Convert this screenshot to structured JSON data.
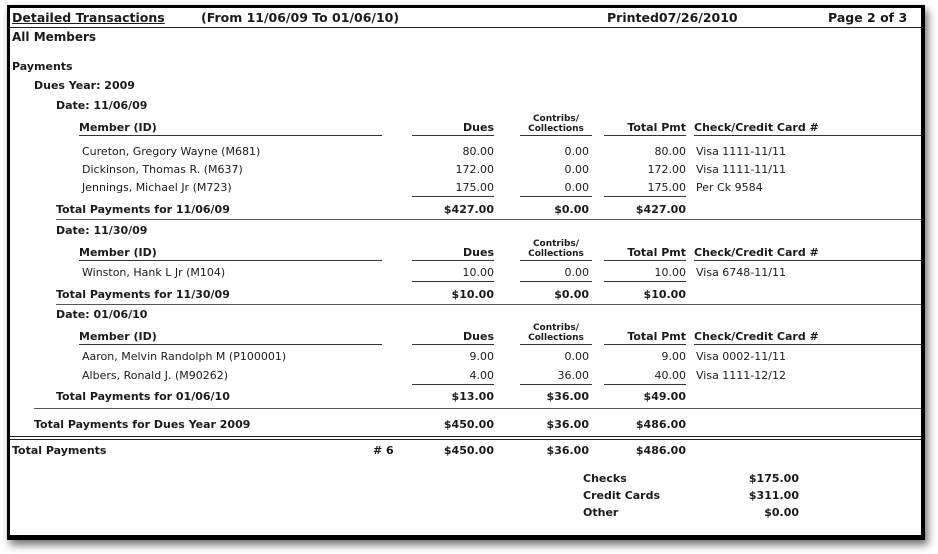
{
  "header": {
    "title": "Detailed Transactions",
    "range": "(From 11/06/09 To 01/06/10)",
    "printed": "Printed07/26/2010",
    "page": "Page 2 of 3",
    "scope": "All Members"
  },
  "section": "Payments",
  "dues_year_label": "Dues Year:  2009",
  "columns": {
    "member": "Member (ID)",
    "dues": "Dues",
    "contribs_1": "Contribs/",
    "contribs_2": "Collections",
    "total": "Total Pmt",
    "card": "Check/Credit Card #"
  },
  "groups": [
    {
      "date_label": "Date:  11/06/09",
      "rows": [
        {
          "member": "Cureton, Gregory Wayne (M681)",
          "dues": "80.00",
          "contribs": "0.00",
          "total": "80.00",
          "card": "Visa 1111-11/11"
        },
        {
          "member": "Dickinson, Thomas R. (M637)",
          "dues": "172.00",
          "contribs": "0.00",
          "total": "172.00",
          "card": "Visa 1111-11/11"
        },
        {
          "member": "Jennings, Michael Jr (M723)",
          "dues": "175.00",
          "contribs": "0.00",
          "total": "175.00",
          "card": "Per Ck 9584"
        }
      ],
      "total_label": "Total Payments for 11/06/09",
      "total_dues": "$427.00",
      "total_contribs": "$0.00",
      "total_total": "$427.00"
    },
    {
      "date_label": "Date:  11/30/09",
      "rows": [
        {
          "member": "Winston, Hank L Jr (M104)",
          "dues": "10.00",
          "contribs": "0.00",
          "total": "10.00",
          "card": "Visa 6748-11/11"
        }
      ],
      "total_label": "Total Payments for 11/30/09",
      "total_dues": "$10.00",
      "total_contribs": "$0.00",
      "total_total": "$10.00"
    },
    {
      "date_label": "Date:  01/06/10",
      "rows": [
        {
          "member": "Aaron, Melvin Randolph M (P100001)",
          "dues": "9.00",
          "contribs": "0.00",
          "total": "9.00",
          "card": "Visa 0002-11/11"
        },
        {
          "member": "Albers, Ronald J. (M90262)",
          "dues": "4.00",
          "contribs": "36.00",
          "total": "40.00",
          "card": "Visa 1111-12/12"
        }
      ],
      "total_label": "Total Payments for 01/06/10",
      "total_dues": "$13.00",
      "total_contribs": "$36.00",
      "total_total": "$49.00"
    }
  ],
  "year_total": {
    "label": "Total Payments for Dues Year 2009",
    "dues": "$450.00",
    "contribs": "$36.00",
    "total": "$486.00"
  },
  "grand_total": {
    "label": "Total Payments",
    "count": "# 6",
    "dues": "$450.00",
    "contribs": "$36.00",
    "total": "$486.00"
  },
  "summary": [
    {
      "label": "Checks",
      "value": "$175.00"
    },
    {
      "label": "Credit Cards",
      "value": "$311.00"
    },
    {
      "label": "Other",
      "value": "$0.00"
    }
  ]
}
